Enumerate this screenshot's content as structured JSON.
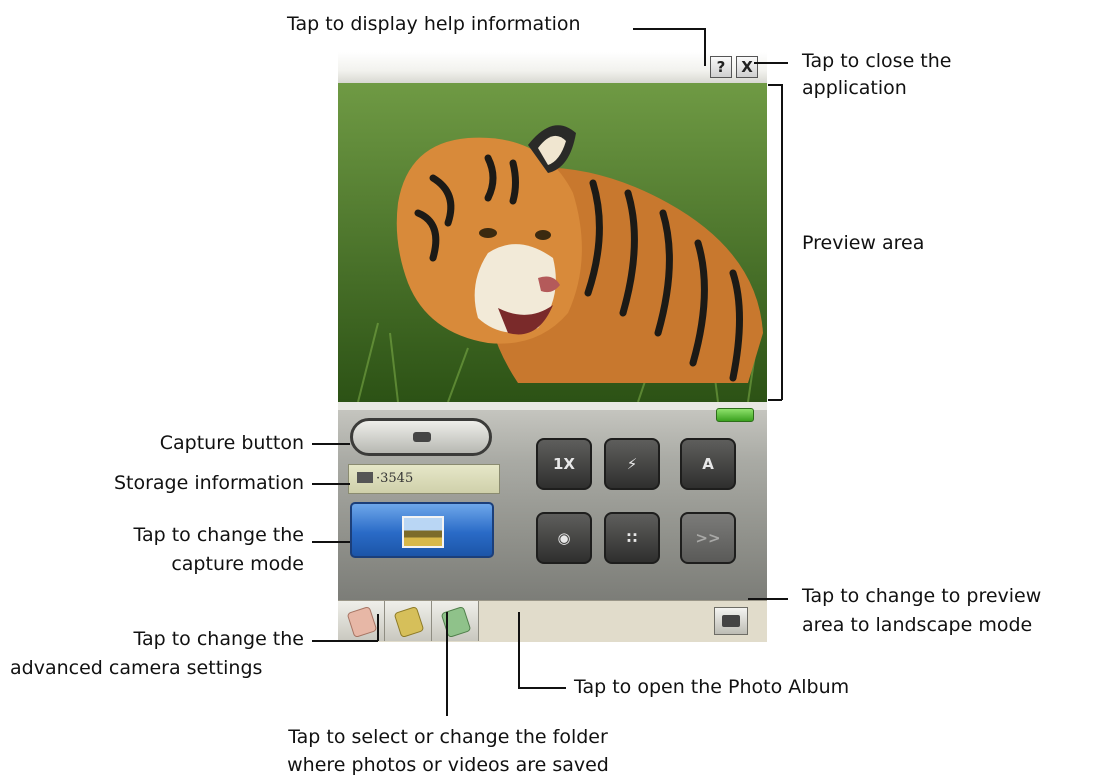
{
  "callouts": {
    "help": "Tap to display help information",
    "close_line1": "Tap to close the",
    "close_line2": "application",
    "preview": "Preview area",
    "capture": "Capture button",
    "storage": "Storage information",
    "mode_line1": "Tap to change the",
    "mode_line2": "capture mode",
    "landscape_line1": "Tap to change to preview",
    "landscape_line2": "area to landscape mode",
    "advanced_line1": "Tap to change the",
    "advanced_line2": "advanced camera settings",
    "album": "Tap to open the Photo Album",
    "folder_line1": "Tap to select or change the folder",
    "folder_line2": "where photos or videos are saved"
  },
  "device": {
    "help_glyph": "?",
    "close_glyph": "X",
    "storage_value": "3545",
    "zoom_label": "1X",
    "flash_glyph": "⚡",
    "auto_label": "A",
    "grid_glyph": "∷",
    "next_glyph": ">>"
  },
  "colors": {
    "accent_blue": "#2a6bc7",
    "indicator_green": "#3aa11f",
    "tiger_orange": "#c8782e"
  },
  "icons": [
    "help-icon",
    "close-icon",
    "camera-icon",
    "memory-card-icon",
    "flash-icon",
    "self-timer-icon",
    "grid-icon",
    "settings-icon",
    "folder-icon",
    "photo-album-icon",
    "landscape-rotate-icon"
  ]
}
